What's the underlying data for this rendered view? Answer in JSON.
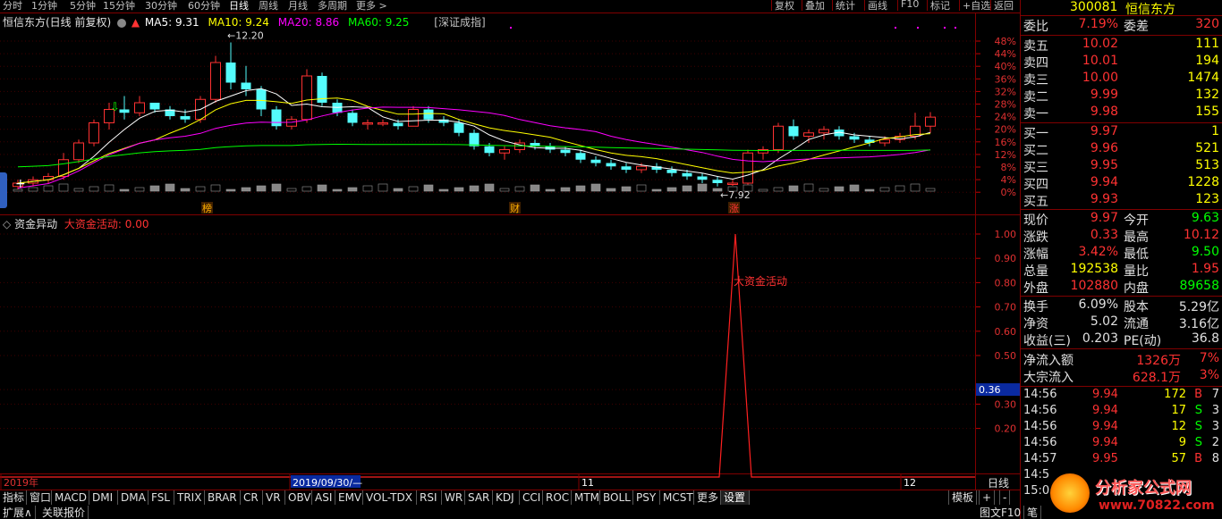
{
  "toolbar": {
    "periods": [
      "分时",
      "1分钟",
      "5分钟",
      "15分钟",
      "30分钟",
      "60分钟",
      "日线",
      "周线",
      "月线",
      "多周期",
      "更多 >"
    ],
    "active_period": "日线",
    "buttons": [
      "复权",
      "叠加",
      "统计",
      "画线",
      "F10",
      "标记",
      "+自选",
      "返回"
    ]
  },
  "main_chart": {
    "title": "恒信东方(日线 前复权)",
    "ma5_label": "MA5: 9.31",
    "ma10_label": "MA10: 9.24",
    "ma20_label": "MA20: 8.86",
    "ma60_label": "MA60: 9.25",
    "overlay_label": "[深证成指]",
    "high_marker": "12.20",
    "low_marker": "7.92",
    "bottom_tags": [
      "榜",
      "财",
      "涨"
    ],
    "pct_axis": [
      "48%",
      "44%",
      "40%",
      "36%",
      "32%",
      "28%",
      "24%",
      "20%",
      "16%",
      "12%",
      "8%",
      "4%",
      "0%"
    ],
    "colors": {
      "up": "#ff3232",
      "down": "#54fcfc",
      "ma5": "#ffffff",
      "ma10": "#ffff00",
      "ma20": "#ff00ff",
      "ma60": "#00ff00"
    }
  },
  "indicator": {
    "title": "资金异动",
    "series_label": "大资金活动: 0.00",
    "peak_label": "大资金活动",
    "y_axis": [
      "1.00",
      "0.90",
      "0.80",
      "0.70",
      "0.60",
      "0.50",
      "0.36",
      "0.30",
      "0.20"
    ],
    "current_value": "0.36"
  },
  "date_axis": {
    "labels": [
      "2019年",
      "2019/09/30/—",
      "11",
      "12"
    ],
    "period": "日线"
  },
  "chart_data": {
    "type": "line",
    "series": [
      {
        "name": "大资金活动",
        "values": [
          0,
          0,
          0,
          0,
          0,
          0,
          0,
          0,
          0,
          0,
          0,
          0,
          0,
          0,
          0,
          0,
          0,
          0,
          0,
          0,
          0,
          0,
          0,
          0,
          0,
          0,
          0,
          0,
          0,
          0,
          0,
          0,
          0,
          0,
          0,
          0,
          0,
          0,
          0,
          0,
          0,
          0,
          0,
          0,
          0,
          0,
          0,
          0,
          0,
          0,
          0,
          0,
          0,
          0,
          0,
          0,
          0,
          0,
          0,
          0,
          0,
          0,
          0,
          0,
          0,
          0,
          0,
          0,
          0,
          0,
          0,
          0,
          1,
          0,
          0,
          0,
          0,
          0,
          0,
          0,
          0,
          0,
          0,
          0,
          0,
          0,
          0,
          0,
          0,
          0
        ]
      }
    ],
    "ylim": [
      0,
      1
    ],
    "candles_ohlc": [
      [
        7.9,
        8.1,
        7.8,
        8.0
      ],
      [
        8.0,
        8.2,
        7.9,
        8.1
      ],
      [
        8.1,
        8.3,
        8.0,
        8.2
      ],
      [
        8.2,
        8.9,
        8.1,
        8.7
      ],
      [
        8.7,
        9.3,
        8.6,
        9.2
      ],
      [
        9.2,
        9.9,
        9.1,
        9.8
      ],
      [
        9.8,
        10.4,
        9.6,
        10.2
      ],
      [
        10.2,
        10.6,
        9.9,
        10.1
      ],
      [
        10.1,
        10.6,
        10.0,
        10.4
      ],
      [
        10.4,
        10.3,
        10.1,
        10.2
      ],
      [
        10.2,
        10.3,
        9.9,
        10.0
      ],
      [
        10.0,
        10.2,
        9.8,
        9.9
      ],
      [
        9.9,
        10.6,
        9.8,
        10.5
      ],
      [
        10.5,
        11.8,
        10.4,
        11.6
      ],
      [
        11.6,
        12.2,
        10.8,
        11.0
      ],
      [
        11.0,
        11.5,
        10.6,
        10.8
      ],
      [
        10.8,
        10.9,
        10.0,
        10.2
      ],
      [
        10.2,
        10.3,
        9.6,
        9.7
      ],
      [
        9.7,
        10.0,
        9.6,
        9.9
      ],
      [
        9.9,
        11.4,
        9.8,
        11.2
      ],
      [
        11.2,
        11.3,
        10.3,
        10.4
      ],
      [
        10.4,
        10.5,
        10.0,
        10.1
      ],
      [
        10.1,
        10.2,
        9.7,
        9.8
      ],
      [
        9.8,
        9.9,
        9.6,
        9.8
      ],
      [
        9.8,
        9.9,
        9.7,
        9.8
      ],
      [
        9.8,
        9.9,
        9.6,
        9.7
      ],
      [
        9.7,
        10.3,
        9.7,
        10.2
      ],
      [
        10.2,
        10.3,
        9.8,
        9.9
      ],
      [
        9.9,
        10.0,
        9.7,
        9.8
      ],
      [
        9.8,
        9.9,
        9.4,
        9.5
      ],
      [
        9.5,
        9.6,
        9.0,
        9.1
      ],
      [
        9.1,
        9.2,
        8.8,
        8.9
      ],
      [
        8.9,
        9.1,
        8.7,
        9.0
      ],
      [
        9.0,
        9.3,
        8.9,
        9.2
      ],
      [
        9.2,
        9.3,
        9.0,
        9.1
      ],
      [
        9.1,
        9.2,
        8.9,
        9.0
      ],
      [
        9.0,
        9.1,
        8.8,
        8.9
      ],
      [
        8.9,
        9.0,
        8.6,
        8.7
      ],
      [
        8.7,
        8.8,
        8.5,
        8.6
      ],
      [
        8.6,
        8.7,
        8.4,
        8.5
      ],
      [
        8.5,
        8.6,
        8.3,
        8.4
      ],
      [
        8.4,
        8.6,
        8.3,
        8.5
      ],
      [
        8.5,
        8.6,
        8.3,
        8.4
      ],
      [
        8.4,
        8.5,
        8.2,
        8.3
      ],
      [
        8.3,
        8.4,
        8.1,
        8.2
      ],
      [
        8.2,
        8.3,
        8.0,
        8.1
      ],
      [
        8.1,
        8.2,
        7.9,
        8.0
      ],
      [
        8.0,
        8.1,
        7.92,
        8.0
      ],
      [
        8.0,
        9.0,
        7.95,
        8.9
      ],
      [
        8.9,
        9.1,
        8.7,
        9.0
      ],
      [
        9.0,
        9.8,
        8.9,
        9.7
      ],
      [
        9.7,
        9.9,
        9.3,
        9.4
      ],
      [
        9.4,
        9.6,
        9.2,
        9.5
      ],
      [
        9.5,
        9.7,
        9.3,
        9.6
      ],
      [
        9.6,
        9.7,
        9.3,
        9.4
      ],
      [
        9.4,
        9.5,
        9.2,
        9.3
      ],
      [
        9.3,
        9.4,
        9.1,
        9.2
      ],
      [
        9.2,
        9.4,
        9.1,
        9.3
      ],
      [
        9.3,
        9.5,
        9.2,
        9.4
      ],
      [
        9.4,
        10.1,
        9.3,
        9.7
      ],
      [
        9.7,
        10.12,
        9.5,
        9.97
      ]
    ]
  },
  "quote": {
    "code": "300081",
    "name": "恒信东方",
    "weibi_label": "委比",
    "weibi_value": "7.19%",
    "weicha_label": "委差",
    "weicha_value": "320",
    "asks": [
      {
        "label": "卖五",
        "price": "10.02",
        "vol": "111"
      },
      {
        "label": "卖四",
        "price": "10.01",
        "vol": "194"
      },
      {
        "label": "卖三",
        "price": "10.00",
        "vol": "1474"
      },
      {
        "label": "卖二",
        "price": "9.99",
        "vol": "132"
      },
      {
        "label": "卖一",
        "price": "9.98",
        "vol": "155"
      }
    ],
    "bids": [
      {
        "label": "买一",
        "price": "9.97",
        "vol": "1"
      },
      {
        "label": "买二",
        "price": "9.96",
        "vol": "521"
      },
      {
        "label": "买三",
        "price": "9.95",
        "vol": "513"
      },
      {
        "label": "买四",
        "price": "9.94",
        "vol": "1228"
      },
      {
        "label": "买五",
        "price": "9.93",
        "vol": "123"
      }
    ],
    "stats": [
      {
        "l1": "现价",
        "v1": "9.97",
        "l2": "今开",
        "v2": "9.63"
      },
      {
        "l1": "涨跌",
        "v1": "0.33",
        "l2": "最高",
        "v2": "10.12"
      },
      {
        "l1": "涨幅",
        "v1": "3.42%",
        "l2": "最低",
        "v2": "9.50"
      },
      {
        "l1": "总量",
        "v1": "192538",
        "l2": "量比",
        "v2": "1.95"
      },
      {
        "l1": "外盘",
        "v1": "102880",
        "l2": "内盘",
        "v2": "89658"
      }
    ],
    "fund": [
      {
        "l1": "换手",
        "v1": "6.09%",
        "l2": "股本",
        "v2": "5.29亿"
      },
      {
        "l1": "净资",
        "v1": "5.02",
        "l2": "流通",
        "v2": "3.16亿"
      },
      {
        "l1": "收益(三)",
        "v1": "0.203",
        "l2": "PE(动)",
        "v2": "36.8"
      }
    ],
    "flow": [
      {
        "label": "净流入额",
        "value": "1326万",
        "pct": "7%"
      },
      {
        "label": "大宗流入",
        "value": "628.1万",
        "pct": "3%"
      }
    ],
    "ticks": [
      {
        "time": "14:56",
        "price": "9.94",
        "vol": "172",
        "bs": "B",
        "n": "7"
      },
      {
        "time": "14:56",
        "price": "9.94",
        "vol": "17",
        "bs": "S",
        "n": "3"
      },
      {
        "time": "14:56",
        "price": "9.94",
        "vol": "12",
        "bs": "S",
        "n": "3"
      },
      {
        "time": "14:56",
        "price": "9.94",
        "vol": "9",
        "bs": "S",
        "n": "2"
      },
      {
        "time": "14:57",
        "price": "9.95",
        "vol": "57",
        "bs": "B",
        "n": "8"
      },
      {
        "time": "14:5",
        "price": "",
        "vol": "",
        "bs": "",
        "n": ""
      },
      {
        "time": "15:0",
        "price": "",
        "vol": "",
        "bs": "",
        "n": ""
      }
    ]
  },
  "bottom_tabs": [
    "指标",
    "窗口",
    "MACD",
    "DMI",
    "DMA",
    "FSL",
    "TRIX",
    "BRAR",
    "CR",
    "VR",
    "OBV",
    "ASI",
    "EMV",
    "VOL-TDX",
    "RSI",
    "WR",
    "SAR",
    "KDJ",
    "CCI",
    "ROC",
    "MTM",
    "BOLL",
    "PSY",
    "MCST",
    "更多",
    "设置"
  ],
  "bottom_right": [
    "模板",
    "+",
    "-"
  ],
  "bottom_row2": [
    "扩展∧",
    "关联报价"
  ],
  "bottom_right2": [
    "图文F10",
    "笔"
  ],
  "watermark": {
    "text": "分析家公式网",
    "url": "www.70822.com"
  }
}
